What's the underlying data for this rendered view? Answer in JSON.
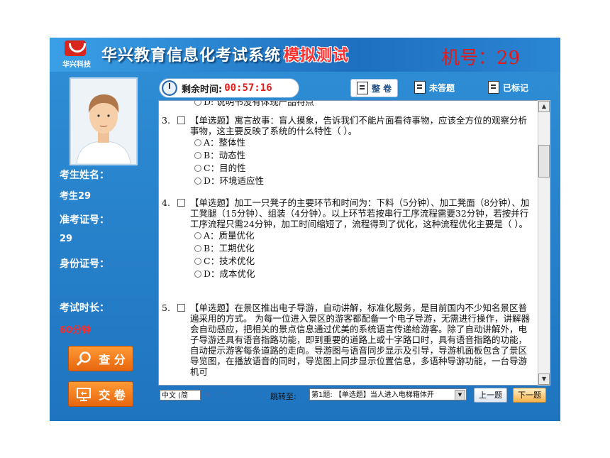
{
  "header": {
    "brand": "华兴科技",
    "title": "华兴教育信息化考试系统",
    "mode_badge": "模拟测试",
    "machine_label": "机号：29"
  },
  "candidate": {
    "name_label": "考生姓名：",
    "name_value": "考生29",
    "ticket_label": "准考证号：",
    "ticket_value": "29",
    "id_label": "身份证号：",
    "id_value": "",
    "duration_label": "考试时长：",
    "duration_value": "60分钟"
  },
  "side_buttons": {
    "score": "查 分",
    "submit": "交 卷"
  },
  "toolbar": {
    "timer_label": "剩余时间:",
    "timer_value": "00:57:16",
    "full": "整 卷",
    "unanswered": "未答题",
    "marked": "已标记"
  },
  "questions": [
    {
      "partial_top": "D: 说明书没有体现产品特点"
    },
    {
      "number": "3.",
      "stem": "【单选题】寓言故事：盲人摸象，告诉我们不能片面看待事物，应该全方位的观察分析事物，这主要反映了系统的什么特性（  ）。",
      "options": [
        "A：整体性",
        "B：动态性",
        "C：目的性",
        "D：环境适应性"
      ]
    },
    {
      "number": "4.",
      "stem": "【单选题】加工一只凳子的主要环节和时间为：下料（5分钟）、加工凳面（8分钟）、加工凳腿（15分钟）、组装（4分钟）。以上环节若按串行工序流程需要32分钟，若按并行工序流程只需24分钟，加工时间缩短了，流程得到了优化，这种流程优化主要是（  ）。",
      "options": [
        "A：质量优化",
        "B：工期优化",
        "C：技术优化",
        "D：成本优化"
      ]
    },
    {
      "number": "5.",
      "stem": "【单选题】在景区推出电子导游，自动讲解，标准化服务，是目前国内不少知名景区普遍采用的方式。 为每一位进入景区的游客都配备一个电子导游，无需进行操作，讲解器会自动感应，把相关的景点信息通过优美的系统语言传递给游客。除了自动讲解外，电子导游还具有语音指路功能，即到重要的道路上或十字路口时，具有语音指路的功能，自动提示游客每条道路的走向。导游图与语音同步显示及引导，导游机面板包含了景区导览图，在播放语音的同时，导览图上同步显示位置信息，多语种导游功能，一台导游机可"
    }
  ],
  "bottom": {
    "ime": "中文 (简",
    "ime_extra": "◥ ☽ °,",
    "jump_label": "跳转至:",
    "jump_value": "第1题: 【单选题】当人进入电梯箱体开",
    "prev": "上一题",
    "next": "下一题"
  },
  "colors": {
    "background": "#2a84cf",
    "accent_red": "#e01b1b",
    "button_orange": "#f08020"
  },
  "icons": [
    "logo-icon",
    "clock-icon",
    "document-icon",
    "search-icon",
    "submit-icon",
    "radio-icon",
    "checkbox-icon"
  ]
}
